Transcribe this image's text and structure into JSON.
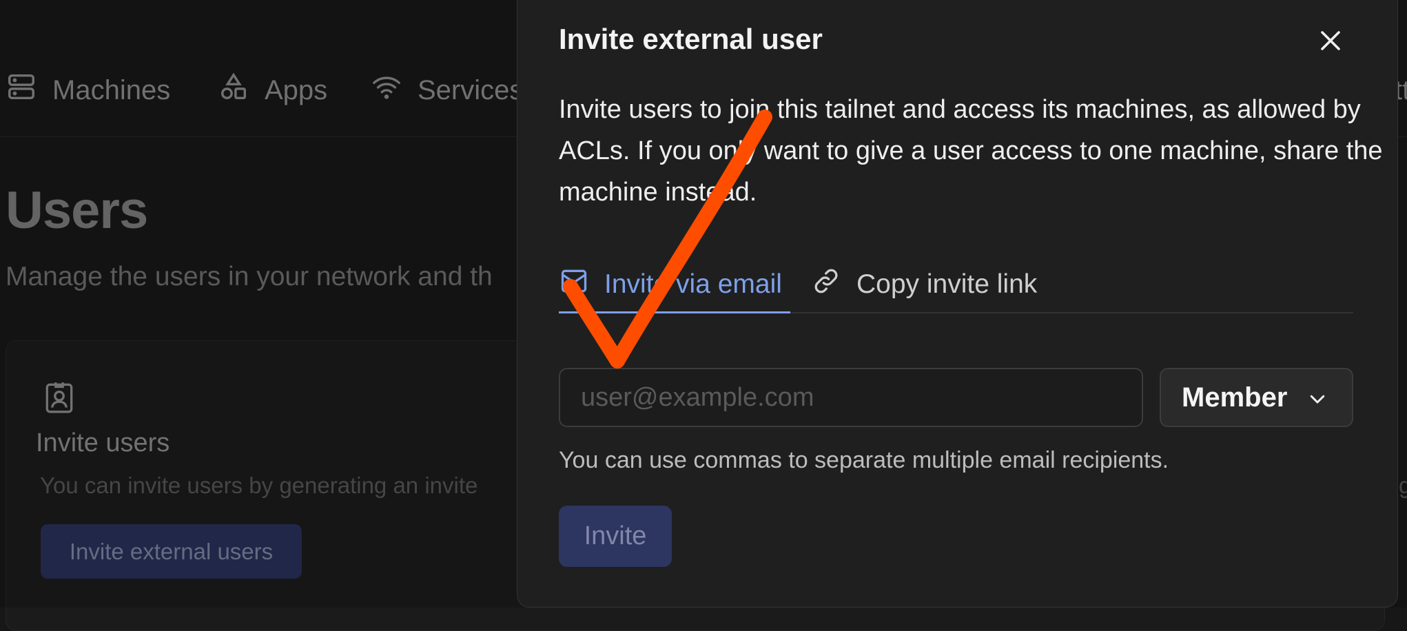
{
  "background": {
    "nav": [
      {
        "label": "Machines",
        "icon": "server-icon"
      },
      {
        "label": "Apps",
        "icon": "shapes-icon"
      },
      {
        "label": "Services",
        "icon": "wifi-icon"
      }
    ],
    "nav_cut_text": "tt",
    "title": "Users",
    "subtitle": "Manage the users in your network and th",
    "card": {
      "icon": "id-badge-icon",
      "title": "Invite users",
      "text": "You can invite users by generating an invite",
      "text_right": "g",
      "button": "Invite external users"
    }
  },
  "modal": {
    "title": "Invite external user",
    "close_icon": "close-icon",
    "description": "Invite users to join this tailnet and access its machines, as allowed by ACLs. If you only want to give a user access to one machine, share the machine instead.",
    "tabs": [
      {
        "label": "Invite via email",
        "icon": "mail-icon",
        "active": true
      },
      {
        "label": "Copy invite link",
        "icon": "link-icon",
        "active": false
      }
    ],
    "email_input": {
      "value": "",
      "placeholder": "user@example.com"
    },
    "role_select": {
      "selected": "Member"
    },
    "helper": "You can use commas to separate multiple email recipients.",
    "invite_button": "Invite"
  },
  "colors": {
    "accent": "#7ea0ea",
    "annotation": "#ff4d00",
    "primary_button": "#2d3561"
  }
}
